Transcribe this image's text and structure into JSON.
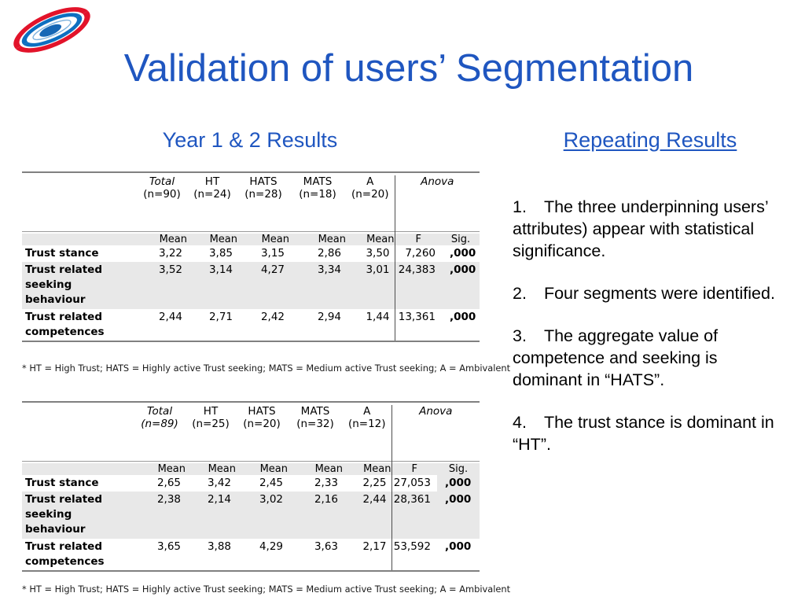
{
  "slide": {
    "title": "Validation of users’ Segmentation",
    "left_subtitle": "Year 1 & 2 Results",
    "right_subtitle": "Repeating Results",
    "title_color": "#1f56c0",
    "logo_name": "spiral-galaxy-logo",
    "logo_colors": {
      "red": "#e2132a",
      "blue": "#0d6fc0",
      "dark_blue": "#1667b5"
    }
  },
  "bullets": [
    {
      "number": "1.",
      "text": "The three underpinning users’ attributes) appear with statistical significance."
    },
    {
      "number": "2.",
      "text": "Four segments were identified."
    },
    {
      "number": "3.",
      "text": "The aggregate value of competence and seeking is dominant in “HATS”."
    },
    {
      "number": "4.",
      "text": "The trust stance is dominant in “HT”."
    }
  ],
  "tables": [
    {
      "id": "table1",
      "group_headers": {
        "row_label": "",
        "columns": [
          {
            "name": "Total",
            "n": "(n=90)",
            "italic": true
          },
          {
            "name": "HT",
            "n": "(n=24)",
            "italic": false
          },
          {
            "name": "HATS",
            "n": "(n=28)",
            "italic": false
          },
          {
            "name": "MATS",
            "n": "(n=18)",
            "italic": false
          },
          {
            "name": "A",
            "n": "(n=20)",
            "italic": false
          }
        ],
        "anova": "Anova"
      },
      "sub_headers": {
        "row_label": "",
        "means": [
          "Mean",
          "Mean",
          "Mean",
          "Mean",
          "Mean"
        ],
        "f": "F",
        "sig": "Sig."
      },
      "rows": [
        {
          "label": "Trust stance",
          "means": [
            "3,22",
            "3,85",
            "3,15",
            "2,86",
            "3,50"
          ],
          "f": "7,260",
          "sig": ",000",
          "shaded": false
        },
        {
          "label": "Trust related seeking behaviour",
          "means": [
            "3,52",
            "3,14",
            "4,27",
            "3,34",
            "3,01"
          ],
          "f": "24,383",
          "sig": ",000",
          "shaded": true
        },
        {
          "label": "Trust related competences",
          "means": [
            "2,44",
            "2,71",
            "2,42",
            "2,94",
            "1,44"
          ],
          "f": "13,361",
          "sig": ",000",
          "shaded": false
        }
      ],
      "footnote": "* HT = High Trust; HATS = Highly active Trust seeking; MATS = Medium active Trust seeking; A = Ambivalent"
    },
    {
      "id": "table2",
      "group_headers": {
        "row_label": "",
        "columns": [
          {
            "name": "Total",
            "n": "(n=89)",
            "italic": true
          },
          {
            "name": "HT",
            "n": "(n=25)",
            "italic": false
          },
          {
            "name": "HATS",
            "n": "(n=20)",
            "italic": false
          },
          {
            "name": "MATS",
            "n": "(n=32)",
            "italic": false
          },
          {
            "name": "A",
            "n": "(n=12)",
            "italic": false
          }
        ],
        "anova": "Anova"
      },
      "sub_headers": {
        "row_label": "",
        "means": [
          "Mean",
          "Mean",
          "Mean",
          "Mean",
          "Mean"
        ],
        "f": "F",
        "sig": "Sig."
      },
      "rows": [
        {
          "label": "Trust stance",
          "means": [
            "2,65",
            "3,42",
            "2,45",
            "2,33",
            "2,25"
          ],
          "f": "27,053",
          "sig": ",000",
          "shaded": false
        },
        {
          "label": "Trust related seeking behaviour",
          "means": [
            "2,38",
            "2,14",
            "3,02",
            "2,16",
            "2,44"
          ],
          "f": "28,361",
          "sig": ",000",
          "shaded": true
        },
        {
          "label": "Trust related competences",
          "means": [
            "3,65",
            "3,88",
            "4,29",
            "3,63",
            "2,17"
          ],
          "f": "53,592",
          "sig": ",000",
          "shaded": false
        }
      ],
      "footnote": "* HT = High Trust; HATS = Highly active Trust seeking; MATS = Medium active Trust seeking; A = Ambivalent"
    }
  ]
}
